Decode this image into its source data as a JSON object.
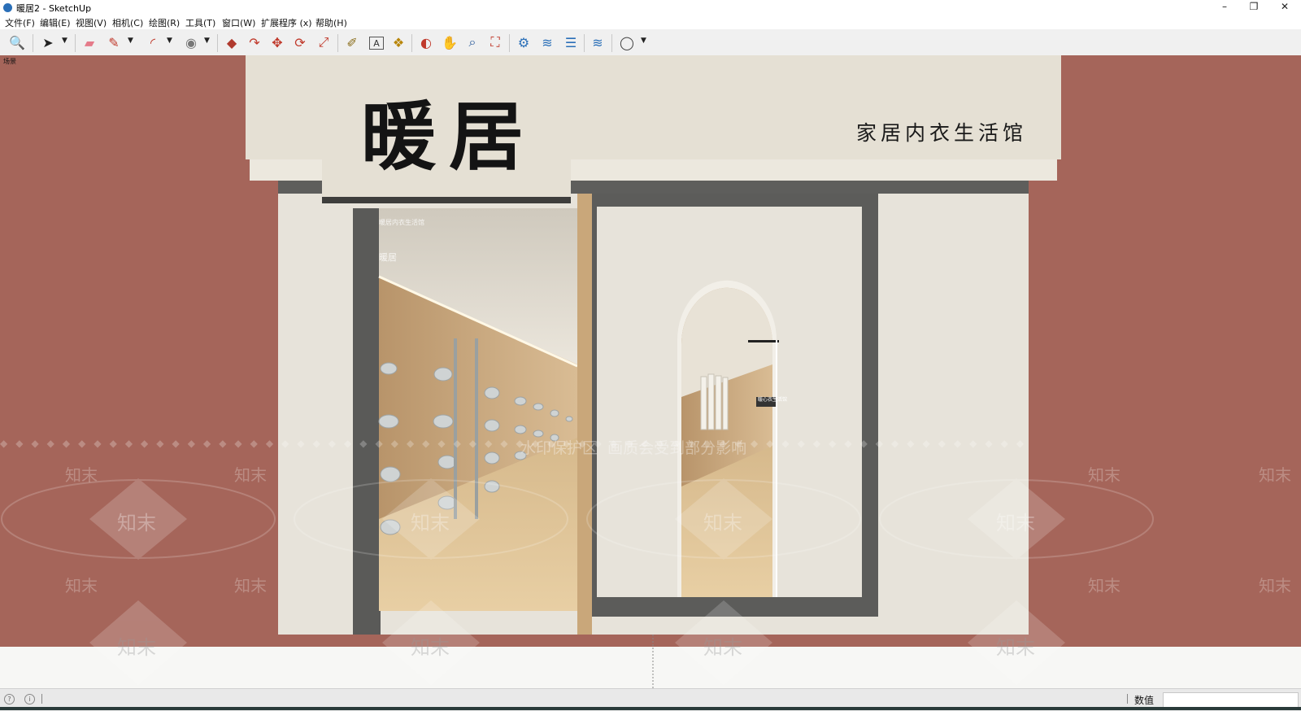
{
  "window": {
    "title": "暖居2 - SketchUp",
    "controls": {
      "minimize": "–",
      "restore": "❐",
      "close": "✕"
    }
  },
  "menu": [
    {
      "label": "文件(F)"
    },
    {
      "label": "编辑(E)"
    },
    {
      "label": "视图(V)"
    },
    {
      "label": "相机(C)"
    },
    {
      "label": "绘图(R)"
    },
    {
      "label": "工具(T)"
    },
    {
      "label": "窗口(W)"
    },
    {
      "label": "扩展程序 (x)"
    },
    {
      "label": "帮助(H)"
    }
  ],
  "toolbar": {
    "tools": [
      {
        "name": "zoom-icon",
        "glyph": "🔍"
      },
      {
        "name": "select-icon",
        "glyph": "➤"
      },
      {
        "name": "eraser-icon",
        "glyph": "▰"
      },
      {
        "name": "pencil-icon",
        "glyph": "✎"
      },
      {
        "name": "arc-icon",
        "glyph": "◜"
      },
      {
        "name": "shape-icon",
        "glyph": "◉"
      },
      {
        "name": "push-pull-icon",
        "glyph": "◆"
      },
      {
        "name": "follow-me-icon",
        "glyph": "↷"
      },
      {
        "name": "move-icon",
        "glyph": "✥"
      },
      {
        "name": "rotate-icon",
        "glyph": "⟳"
      },
      {
        "name": "scale-icon",
        "glyph": "⤢"
      },
      {
        "name": "tape-measure-icon",
        "glyph": "✐"
      },
      {
        "name": "text-icon",
        "glyph": "A"
      },
      {
        "name": "paint-bucket-icon",
        "glyph": "❖"
      },
      {
        "name": "orbit-icon",
        "glyph": "◐"
      },
      {
        "name": "pan-icon",
        "glyph": "✋"
      },
      {
        "name": "zoom-tool-icon",
        "glyph": "⌕"
      },
      {
        "name": "zoom-extents-icon",
        "glyph": "⛶"
      },
      {
        "name": "warehouse-icon",
        "glyph": "⚙"
      },
      {
        "name": "extension-warehouse-icon",
        "glyph": "≋"
      },
      {
        "name": "layout-icon",
        "glyph": "☰"
      },
      {
        "name": "extension-manager-icon",
        "glyph": "≋"
      },
      {
        "name": "account-icon",
        "glyph": "◯"
      }
    ]
  },
  "viewport": {
    "scene_tab": "场景",
    "sign": {
      "brand_char1": "暖",
      "brand_char2": "居",
      "tagline": "家居内衣生活馆"
    },
    "interior_labels": {
      "small1": "暖居内衣生活馆",
      "small2": "暖居",
      "arch_plate": "暖心衣生活馆"
    },
    "watermark": {
      "logo": "知末",
      "notice": "水印保护区  画质会受到部分影响"
    }
  },
  "status": {
    "vcb_label": "数值",
    "vcb_value": ""
  }
}
